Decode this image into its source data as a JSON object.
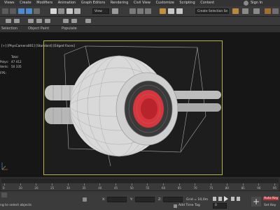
{
  "menu": [
    "Views",
    "Create",
    "Modifiers",
    "Animation",
    "Graph Editors",
    "Rendering",
    "Civil View",
    "Customize",
    "Scripting",
    "Content"
  ],
  "signin": "Sign In",
  "toolbar": {
    "view_dropdown": "View",
    "selection_set": "Create Selection Se"
  },
  "ribbon_labels": [
    "Selection",
    "Object Paint",
    "Populate"
  ],
  "viewport": {
    "label": "[+] [PhysCamera001] [Standard] [Edged Faces]",
    "stats": [
      {
        "name": "Total",
        "value": ""
      },
      {
        "name": "Polys:",
        "value": "47 412"
      },
      {
        "name": "Verts:",
        "value": "50 335"
      },
      {
        "name": "FPS:",
        "value": ""
      }
    ]
  },
  "timeline": {
    "ticks": [
      "0",
      "10",
      "20",
      "25",
      "30",
      "35",
      "40",
      "45",
      "50",
      "55",
      "60",
      "65",
      "70",
      "75",
      "80",
      "85",
      "90",
      "95"
    ]
  },
  "status": {
    "hint": "ng to select objects",
    "x_label": "X:",
    "y_label": "Y:",
    "z_label": "Z:",
    "grid": "Grid = 10,0m",
    "add_time_tag": "Add Time Tag",
    "auto_key": "Auto Key",
    "set_key": "Set Key",
    "frame_value": "0"
  },
  "colors": {
    "accent_red": "#d9353c",
    "safe_frame": "#b7b24a",
    "key_red": "#b93838"
  }
}
